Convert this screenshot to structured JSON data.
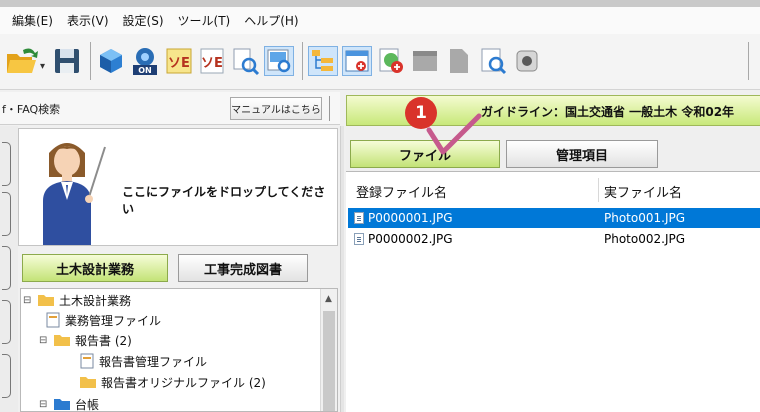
{
  "menubar": {
    "items": [
      "編集(E)",
      "表示(V)",
      "設定(S)",
      "ツール(T)",
      "ヘルプ(H)"
    ]
  },
  "toolbar": {
    "icons": [
      "open-folder-icon",
      "save-icon",
      "3d-icon",
      "on-icon",
      "ye-icon",
      "ye-icon",
      "search-icon",
      "preview-icon",
      "tree-icon",
      "window-icon",
      "globe-icon",
      "gray-window-icon",
      "gray-doc-icon",
      "zoom-doc-icon",
      "device-icon"
    ]
  },
  "faq": {
    "label": "f・FAQ検索",
    "manual_button": "マニュアルはこちら"
  },
  "guide": {
    "text": "ガイドライン：国土交通省 一般土木 令和02年"
  },
  "drop": {
    "text": "ここにファイルをドロップしてください"
  },
  "left_tabs": {
    "active": "土木設計業務",
    "inactive": "工事完成図書"
  },
  "tree": [
    {
      "label": "土木設計業務",
      "expand": "⊟"
    },
    {
      "label": "業務管理ファイル"
    },
    {
      "label": "報告書 (2)",
      "expand": "⊟"
    },
    {
      "label": "報告書管理ファイル"
    },
    {
      "label": "報告書オリジナルファイル (2)"
    },
    {
      "label": "台帳",
      "expand": "⊟"
    }
  ],
  "right_tabs": {
    "active": "ファイル",
    "inactive": "管理項目"
  },
  "filelist": {
    "columns": [
      "登録ファイル名",
      "実ファイル名"
    ],
    "rows": [
      {
        "name": "P0000001.JPG",
        "real": "Photo001.JPG",
        "selected": true
      },
      {
        "name": "P0000002.JPG",
        "real": "Photo002.JPG",
        "selected": false
      }
    ]
  },
  "callout": {
    "number": "1"
  },
  "colors": {
    "callout": "#d9332b",
    "selection": "#0078d7",
    "tab_green": "#c3e377"
  }
}
